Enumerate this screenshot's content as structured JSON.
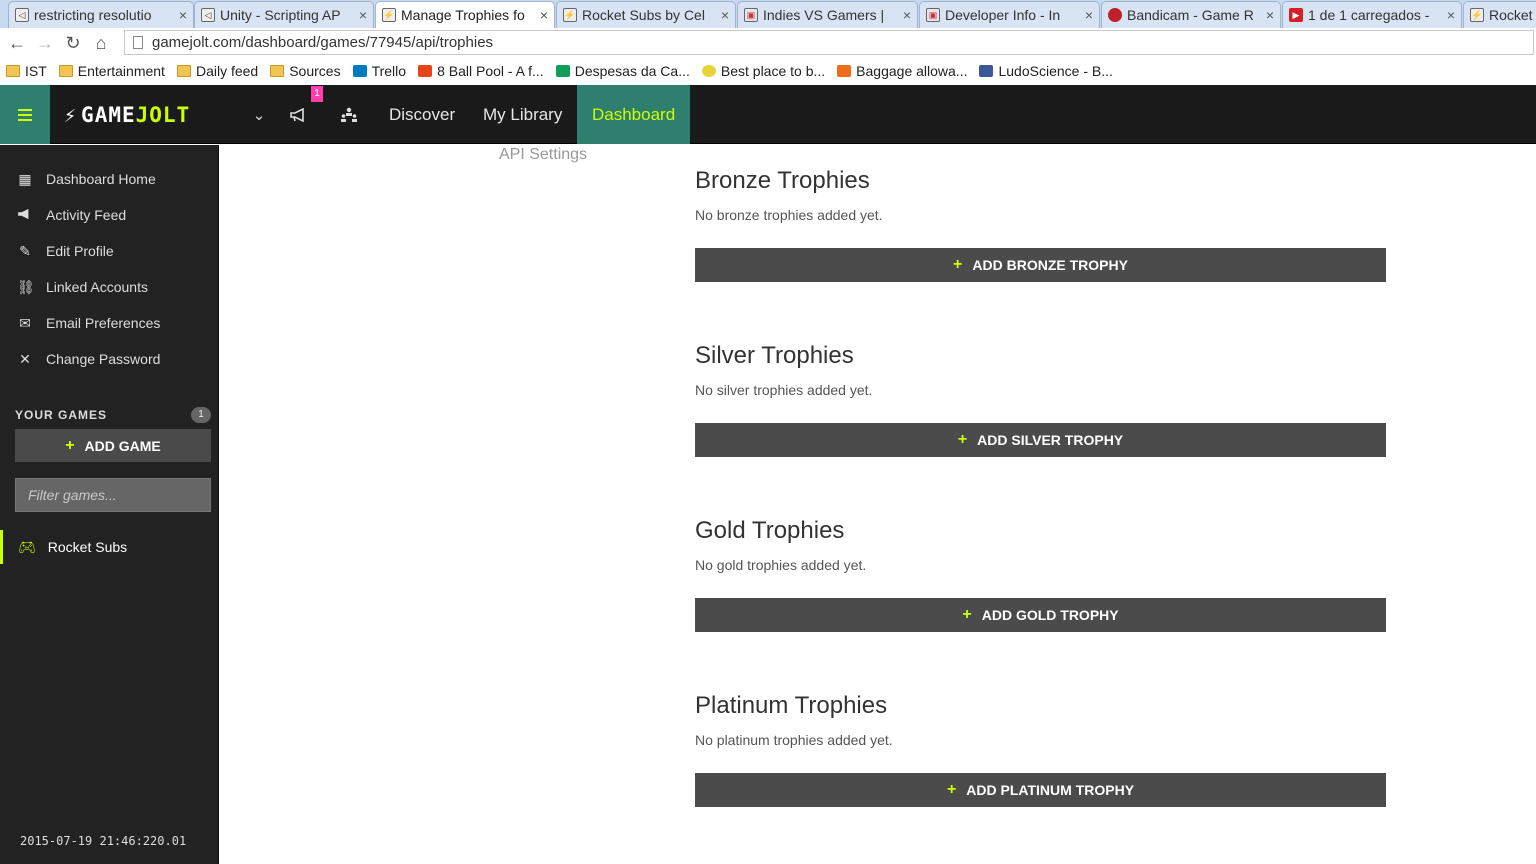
{
  "browser": {
    "tabs": [
      {
        "label": "restricting resolutio",
        "icon": "unity-icon"
      },
      {
        "label": "Unity - Scripting AP",
        "icon": "unity-icon"
      },
      {
        "label": "Manage Trophies fo",
        "icon": "gamejolt-icon",
        "active": true
      },
      {
        "label": "Rocket Subs by Cel",
        "icon": "gamejolt-icon"
      },
      {
        "label": "Indies VS Gamers |",
        "icon": "page-icon"
      },
      {
        "label": "Developer Info - In",
        "icon": "page-icon"
      },
      {
        "label": "Bandicam - Game R",
        "icon": "bandicam-icon"
      },
      {
        "label": "1 de 1 carregados -",
        "icon": "youtube-icon"
      },
      {
        "label": "Rocket",
        "icon": "gamejolt-icon"
      }
    ],
    "close_glyph": "×",
    "url": "gamejolt.com/dashboard/games/77945/api/trophies",
    "bookmarks": [
      {
        "label": "IST",
        "icon": "folder"
      },
      {
        "label": "Entertainment",
        "icon": "folder"
      },
      {
        "label": "Daily feed",
        "icon": "folder"
      },
      {
        "label": "Sources",
        "icon": "folder"
      },
      {
        "label": "Trello",
        "icon": "trello"
      },
      {
        "label": "8 Ball Pool - A f...",
        "icon": "pool"
      },
      {
        "label": "Despesas da Ca...",
        "icon": "sheets"
      },
      {
        "label": "Best place to b...",
        "icon": "smile"
      },
      {
        "label": "Baggage allowa...",
        "icon": "baggage"
      },
      {
        "label": "LudoScience - B...",
        "icon": "fb"
      }
    ]
  },
  "header": {
    "logo_game": "GAME",
    "logo_jolt": "JOLT",
    "notification_count": "1",
    "nav": {
      "discover": "Discover",
      "library": "My Library",
      "dashboard": "Dashboard"
    },
    "accent": "#ccff00",
    "active_bg": "#2f7f6f"
  },
  "sidebar": {
    "items": [
      {
        "label": "Dashboard Home",
        "icon": "grid-icon"
      },
      {
        "label": "Activity Feed",
        "icon": "megaphone-icon"
      },
      {
        "label": "Edit Profile",
        "icon": "pencil-icon"
      },
      {
        "label": "Linked Accounts",
        "icon": "link-icon"
      },
      {
        "label": "Email Preferences",
        "icon": "envelope-icon"
      },
      {
        "label": "Change Password",
        "icon": "tools-icon"
      }
    ],
    "your_games_label": "YOUR GAMES",
    "games_count": "1",
    "add_game_label": "ADD GAME",
    "filter_placeholder": "Filter games...",
    "games": [
      {
        "label": "Rocket Subs",
        "icon": "gamepad-icon"
      }
    ],
    "timestamp": "2015-07-19 21:46:220.01"
  },
  "main": {
    "api_settings": "API Settings",
    "sections": [
      {
        "title": "Bronze Trophies",
        "empty": "No bronze trophies added yet.",
        "button": "ADD BRONZE TROPHY"
      },
      {
        "title": "Silver Trophies",
        "empty": "No silver trophies added yet.",
        "button": "ADD SILVER TROPHY"
      },
      {
        "title": "Gold Trophies",
        "empty": "No gold trophies added yet.",
        "button": "ADD GOLD TROPHY"
      },
      {
        "title": "Platinum Trophies",
        "empty": "No platinum trophies added yet.",
        "button": "ADD PLATINUM TROPHY"
      }
    ]
  }
}
